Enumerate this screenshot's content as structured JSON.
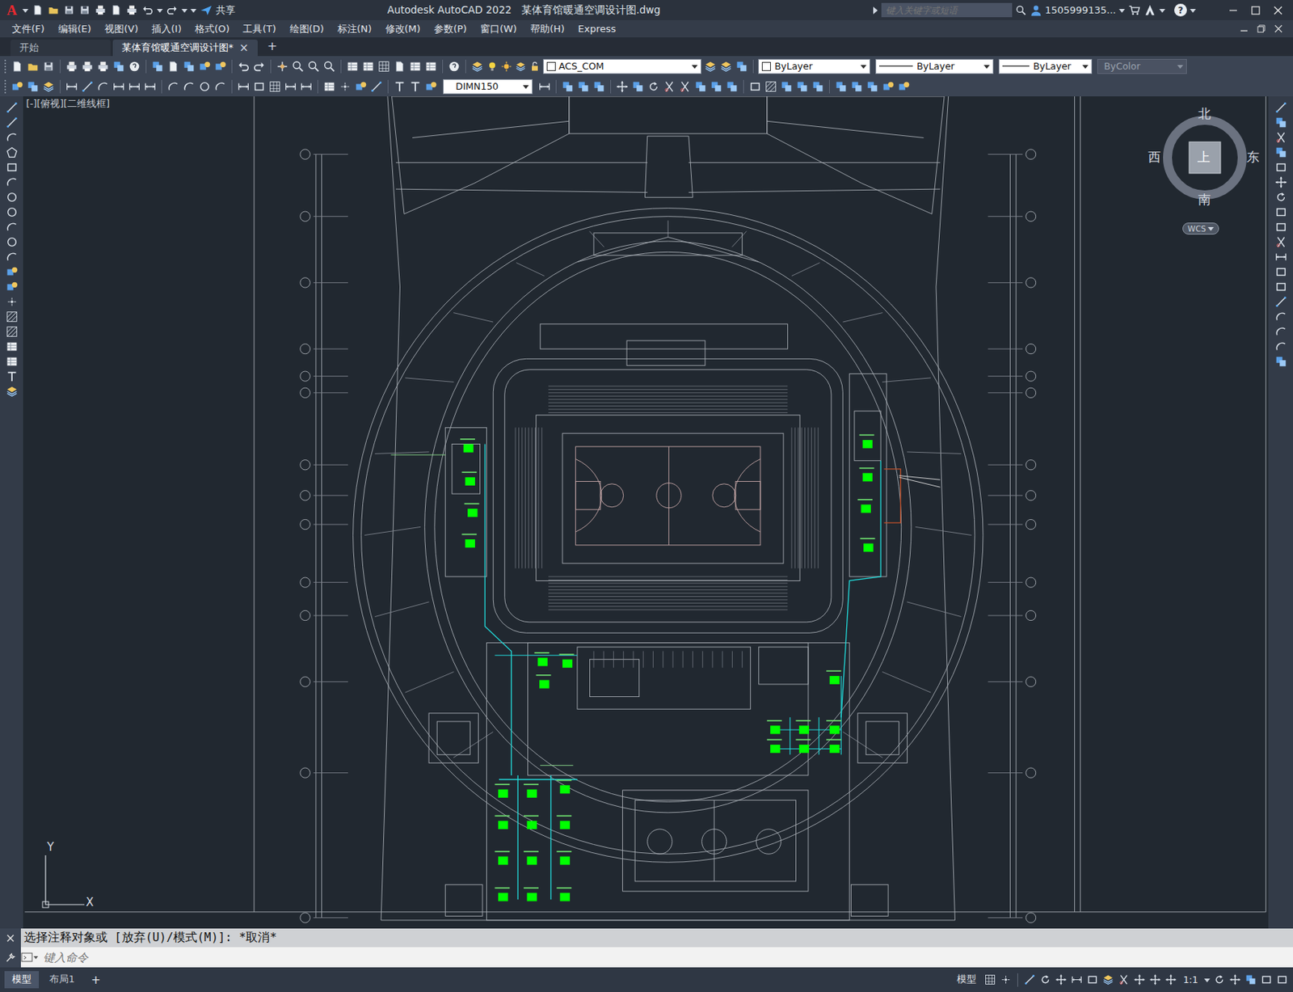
{
  "window": {
    "logo": "A",
    "title": "Autodesk AutoCAD 2022   某体育馆暖通空调设计图.dwg",
    "share": "共享",
    "search_placeholder": "键入关键字或短语",
    "user": "1505999135...",
    "help": "?"
  },
  "menus": [
    "文件(F)",
    "编辑(E)",
    "视图(V)",
    "插入(I)",
    "格式(O)",
    "工具(T)",
    "绘图(D)",
    "标注(N)",
    "修改(M)",
    "参数(P)",
    "窗口(W)",
    "帮助(H)",
    "Express"
  ],
  "doc_tabs": [
    {
      "label": "开始",
      "selected": false,
      "closable": false
    },
    {
      "label": "某体育馆暖通空调设计图*",
      "selected": true,
      "closable": true
    }
  ],
  "tab_close": "×",
  "new_tab": "+",
  "layer": {
    "name": "ACS_COM"
  },
  "properties": [
    {
      "label": "ByLayer",
      "kind": "color",
      "disabled": false
    },
    {
      "label": "ByLayer",
      "kind": "linetype",
      "disabled": false
    },
    {
      "label": "ByLayer",
      "kind": "lineweight",
      "disabled": false
    },
    {
      "label": "ByColor",
      "kind": "plotstyle",
      "disabled": true
    }
  ],
  "dimstyle": "DIMN150",
  "viewport": {
    "label": "[-][俯视][二维线框]"
  },
  "viewcube": {
    "north": "北",
    "south": "南",
    "east": "东",
    "west": "西",
    "face": "上",
    "ucs": "WCS"
  },
  "ucs_axes": {
    "x": "X",
    "y": "Y"
  },
  "command": {
    "history": "选择注释对象或 [放弃(U)/模式(M)]: *取消*",
    "placeholder": "键入命令"
  },
  "layout_tabs": [
    {
      "label": "模型",
      "selected": true
    },
    {
      "label": "布局1",
      "selected": false
    }
  ],
  "add_layout": "+",
  "status_bar": {
    "space": "模型",
    "scale": "1:1"
  }
}
